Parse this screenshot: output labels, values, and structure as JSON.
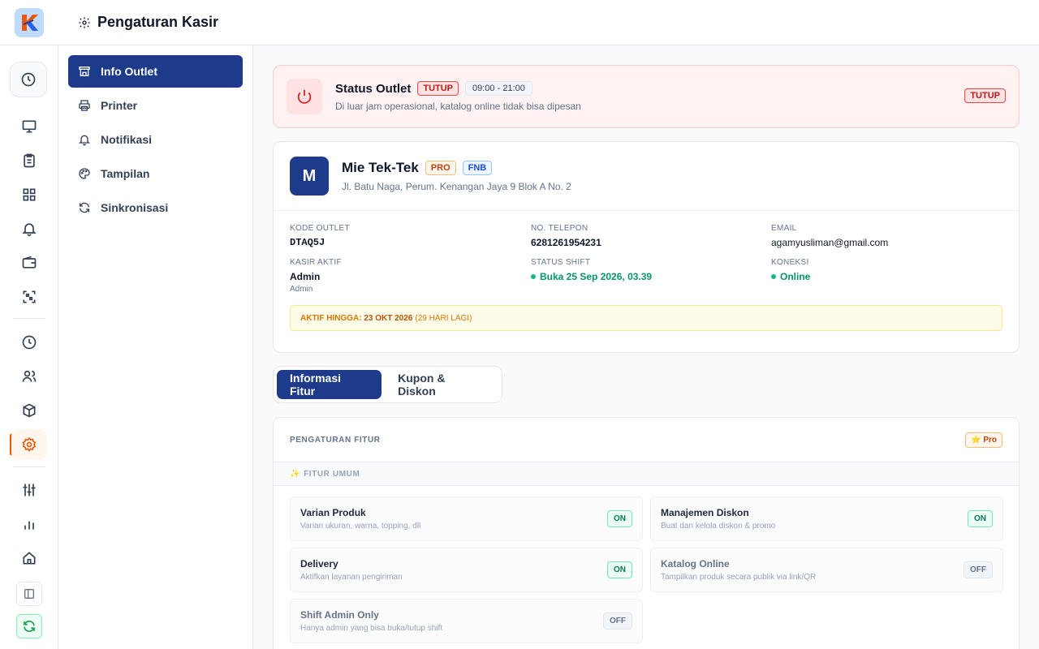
{
  "header": {
    "title": "Pengaturan Kasir",
    "title_icon": "gear-icon",
    "logo_icon": "app-logo"
  },
  "rail": {
    "items": [
      {
        "icon": "clock-icon"
      },
      {
        "icon": "monitor-icon"
      },
      {
        "icon": "clipboard-icon"
      },
      {
        "icon": "grid-icon"
      },
      {
        "icon": "bell-icon"
      },
      {
        "icon": "wallet-icon"
      },
      {
        "icon": "qr-scan-icon"
      },
      {
        "icon": "history-icon"
      },
      {
        "icon": "users-icon"
      },
      {
        "icon": "box-icon"
      },
      {
        "icon": "settings-icon",
        "active": true
      },
      {
        "icon": "sliders-icon"
      },
      {
        "icon": "bar-chart-icon"
      },
      {
        "icon": "home-icon"
      },
      {
        "icon": "sidebar-toggle-icon"
      },
      {
        "icon": "sync-icon"
      }
    ],
    "accent_color": "#ea580c"
  },
  "menu": {
    "items": [
      {
        "label": "Info Outlet",
        "icon": "store-icon",
        "active": true
      },
      {
        "label": "Printer",
        "icon": "printer-icon"
      },
      {
        "label": "Notifikasi",
        "icon": "bell-icon"
      },
      {
        "label": "Tampilan",
        "icon": "palette-icon"
      },
      {
        "label": "Sinkronisasi",
        "icon": "refresh-icon"
      }
    ],
    "active_color": "#1e3a8a"
  },
  "status": {
    "title": "Status Outlet",
    "badge": "TUTUP",
    "hours": "09:00 - 21:00",
    "subtitle": "Di luar jam operasional, katalog online tidak bisa dipesan",
    "right_badge": "TUTUP",
    "icon": "power-icon"
  },
  "outlet": {
    "initial": "M",
    "name": "Mie Tek-Tek",
    "badge_pro": "PRO",
    "badge_type": "FNB",
    "address": "Jl. Batu Naga, Perum. Kenangan Jaya 9 Blok A No. 2",
    "fields": {
      "code_label": "KODE OUTLET",
      "code_value": "DTAQ5J",
      "phone_label": "NO. TELEPON",
      "phone_value": "6281261954231",
      "email_label": "EMAIL",
      "email_value": "agamyusliman@gmail.com",
      "cashier_label": "KASIR AKTIF",
      "cashier_value": "Admin",
      "cashier_role": "Admin",
      "shift_label": "STATUS SHIFT",
      "shift_value": "Buka 25 Sep 2026, 03.39",
      "conn_label": "KONEKSI",
      "conn_value": "Online"
    },
    "active_until": {
      "label": "AKTIF HINGGA:",
      "date": "23 OKT 2026",
      "remaining": "(29 HARI LAGI)"
    }
  },
  "tabs": [
    {
      "label": "Informasi Fitur",
      "active": true
    },
    {
      "label": "Kupon & Diskon"
    }
  ],
  "features": {
    "title": "PENGATURAN FITUR",
    "plan_badge": "⭐ Pro",
    "section": {
      "icon": "✨",
      "label": "FITUR UMUM"
    },
    "items": [
      {
        "name": "Varian Produk",
        "desc": "Varian ukuran, warna, topping, dll",
        "state": "ON"
      },
      {
        "name": "Manajemen Diskon",
        "desc": "Buat dan kelola diskon & promo",
        "state": "ON"
      },
      {
        "name": "Delivery",
        "desc": "Aktifkan layanan pengiriman",
        "state": "ON"
      },
      {
        "name": "Katalog Online",
        "desc": "Tampilkan produk secara publik via link/QR",
        "state": "OFF"
      },
      {
        "name": "Shift Admin Only",
        "desc": "Hanya admin yang bisa buka/tutup shift",
        "state": "OFF"
      }
    ]
  }
}
